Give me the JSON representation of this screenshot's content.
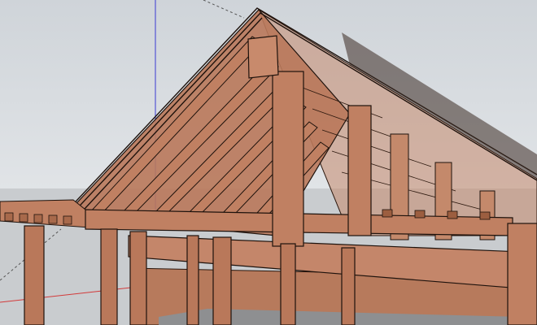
{
  "viewport": {
    "sky_color": "#d9dde1",
    "ground_color": "#c9cccf",
    "wood_color": "#b9785a",
    "wood_dark": "#8f5638",
    "edge_color": "#1e120c",
    "axis_colors": {
      "red": "#d23a3a",
      "green": "#3aa83a",
      "blue": "#3a3ad2"
    }
  }
}
